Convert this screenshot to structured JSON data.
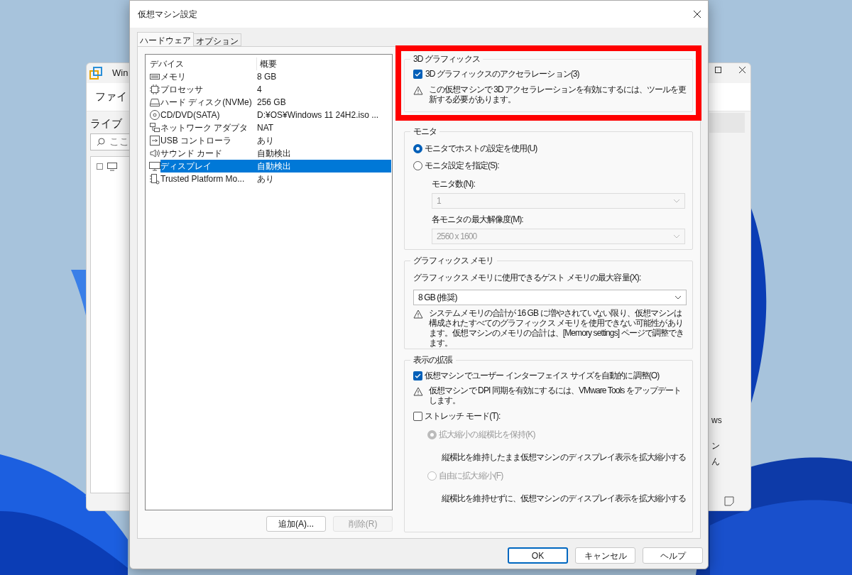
{
  "background_window": {
    "title": "Win",
    "menu": "ファイ",
    "library_label": "ライブ",
    "search_placeholder": "ここ",
    "fragments": [
      "ws",
      "ン",
      "ん"
    ]
  },
  "dialog": {
    "title": "仮想マシン設定",
    "tabs": [
      {
        "label": "ハードウェア",
        "selected": true
      },
      {
        "label": "オプション",
        "selected": false
      }
    ],
    "device_table": {
      "columns": [
        "デバイス",
        "概要"
      ],
      "rows": [
        {
          "kind": "memory",
          "device": "メモリ",
          "summary": "8 GB",
          "selected": false
        },
        {
          "kind": "cpu",
          "device": "プロセッサ",
          "summary": "4",
          "selected": false
        },
        {
          "kind": "disk",
          "device": "ハード ディスク(NVMe)",
          "summary": "256 GB",
          "selected": false
        },
        {
          "kind": "cd",
          "device": "CD/DVD(SATA)",
          "summary": "D:¥OS¥Windows 11 24H2.iso ...",
          "selected": false
        },
        {
          "kind": "network",
          "device": "ネットワーク アダプタ",
          "summary": "NAT",
          "selected": false
        },
        {
          "kind": "usb",
          "device": "USB コントローラ",
          "summary": "あり",
          "selected": false
        },
        {
          "kind": "sound",
          "device": "サウンド カード",
          "summary": "自動検出",
          "selected": false
        },
        {
          "kind": "display",
          "device": "ディスプレイ",
          "summary": "自動検出",
          "selected": true
        },
        {
          "kind": "tpm",
          "device": "Trusted Platform Mo...",
          "summary": "あり",
          "selected": false
        }
      ]
    },
    "device_buttons": [
      {
        "label": "追加(A)...",
        "disabled": false
      },
      {
        "label": "削除(R)",
        "disabled": true
      }
    ],
    "graphics_3d": {
      "title": "3D グラフィックス",
      "highlighted": true,
      "acceleration": {
        "label": "3D グラフィックスのアクセラレーション(3)",
        "checked": true
      },
      "warning": "この仮想マシンで 3D アクセラレーションを有効にするには、ツールを更新する必要があります。"
    },
    "monitor": {
      "title": "モニタ",
      "options": [
        {
          "label": "モニタでホストの設定を使用(U)",
          "selected": true
        },
        {
          "label": "モニタ設定を指定(S):",
          "selected": false
        }
      ],
      "monitor_count": {
        "label": "モニタ数(N):",
        "value": "1",
        "disabled": true
      },
      "max_resolution": {
        "label": "各モニタの最大解像度(M):",
        "value": "2560 x 1600",
        "disabled": true
      }
    },
    "graphics_memory": {
      "title": "グラフィックス メモリ",
      "label": "グラフィックス メモリに使用できるゲスト メモリの最大容量(X):",
      "value": "8 GB (推奨)",
      "warning": "システムメモリの合計が 16 GB に増やされていない限り、仮想マシンは構成されたすべてのグラフィックス メモリを使用できない可能性があります。仮想マシンのメモリの合計は、[Memory settings] ページで調整できます。"
    },
    "display_scaling": {
      "title": "表示の拡張",
      "auto_adjust": {
        "label": "仮想マシンでユーザー インターフェイス サイズを自動的に調整(O)",
        "checked": true
      },
      "warning": "仮想マシンで DPI 同期を有効にするには、VMware Tools をアップデートします。",
      "stretch": {
        "label": "ストレッチ モード(T):",
        "checked": false
      },
      "stretch_options": [
        {
          "label": "拡大縮小の縦横比を保持(K)",
          "description": "縦横比を維持したまま仮想マシンのディスプレイ表示を拡大縮小する",
          "selected": true,
          "disabled": true
        },
        {
          "label": "自由に拡大縮小(F)",
          "description": "縦横比を維持せずに、仮想マシンのディスプレイ表示を拡大縮小する",
          "selected": false,
          "disabled": true
        }
      ]
    },
    "footer_buttons": [
      {
        "label": "OK",
        "default": true
      },
      {
        "label": "キャンセル",
        "default": false
      },
      {
        "label": "ヘルプ",
        "default": false
      }
    ]
  }
}
